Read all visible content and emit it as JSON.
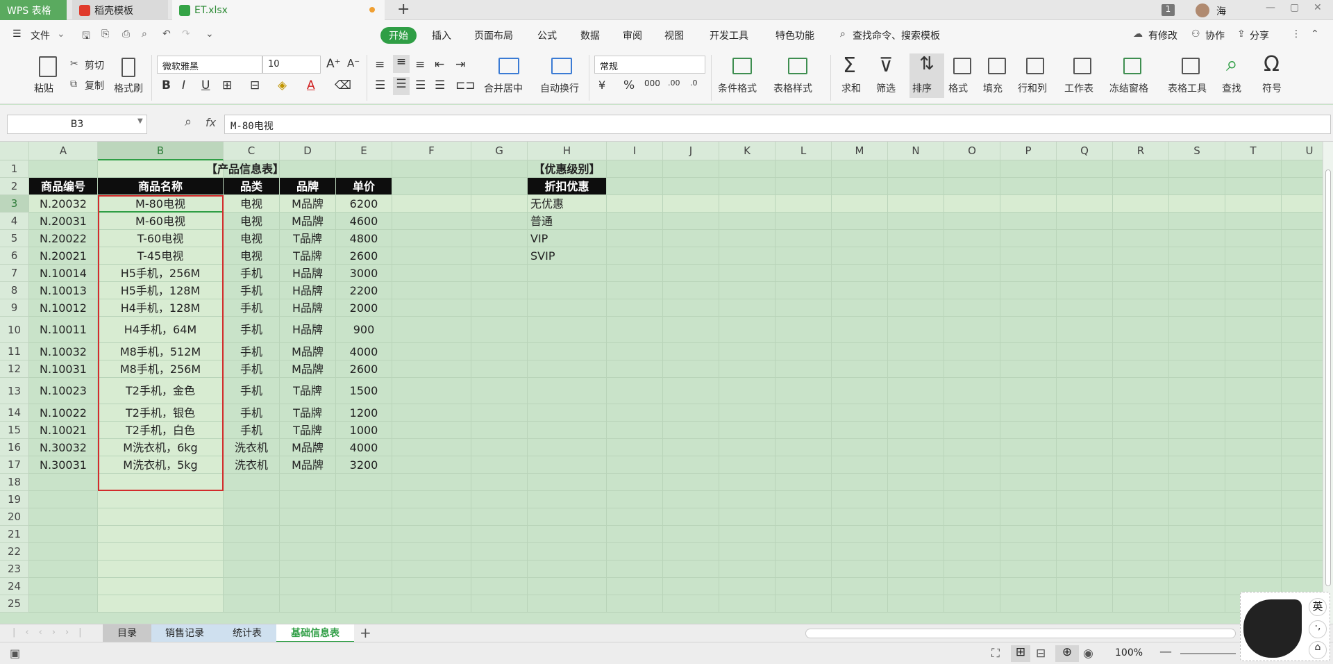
{
  "titlebar": {
    "tabs": [
      {
        "label": "WPS 表格"
      },
      {
        "label": "稻壳模板"
      },
      {
        "label": "ET.xlsx"
      }
    ],
    "add_tab": "+",
    "badge_count": "1",
    "user_name": "海",
    "min": "—",
    "max": "▢",
    "close": "✕"
  },
  "menubar": {
    "file": "文件",
    "items": [
      "开始",
      "插入",
      "页面布局",
      "公式",
      "数据",
      "审阅",
      "视图",
      "开发工具",
      "特色功能"
    ],
    "search": "查找命令、搜索模板",
    "changes": "有修改",
    "collab": "协作",
    "share": "分享"
  },
  "ribbon": {
    "paste": "粘贴",
    "cut": "剪切",
    "copy": "复制",
    "format_painter": "格式刷",
    "font_name": "微软雅黑",
    "font_size": "10",
    "merge": "合并居中",
    "wrap": "自动换行",
    "number_format": "常规",
    "cond_format": "条件格式",
    "table_style": "表格样式",
    "sum": "求和",
    "filter": "筛选",
    "sort": "排序",
    "format": "格式",
    "fill": "填充",
    "rowcol": "行和列",
    "worksheet": "工作表",
    "freeze": "冻结窗格",
    "table_tools": "表格工具",
    "find": "查找",
    "symbol": "符号"
  },
  "formula_bar": {
    "name_box": "B3",
    "fx": "fx",
    "content": "M-80电视"
  },
  "grid": {
    "columns": [
      "A",
      "B",
      "C",
      "D",
      "E",
      "F",
      "G",
      "H",
      "I",
      "J",
      "K",
      "L",
      "M",
      "N",
      "O",
      "P",
      "Q",
      "R",
      "S",
      "T",
      "U"
    ],
    "rows": [
      "1",
      "2",
      "3",
      "4",
      "5",
      "6",
      "7",
      "8",
      "9",
      "10",
      "11",
      "12",
      "13",
      "14",
      "15",
      "16",
      "17",
      "18",
      "19",
      "20",
      "21",
      "22",
      "23",
      "24",
      "25"
    ],
    "product_title": "【产品信息表】",
    "product_headers": [
      "商品编号",
      "商品名称",
      "品类",
      "品牌",
      "单价"
    ],
    "products": [
      [
        "N.20032",
        "M-80电视",
        "电视",
        "M品牌",
        "6200"
      ],
      [
        "N.20031",
        "M-60电视",
        "电视",
        "M品牌",
        "4600"
      ],
      [
        "N.20022",
        "T-60电视",
        "电视",
        "T品牌",
        "4800"
      ],
      [
        "N.20021",
        "T-45电视",
        "电视",
        "T品牌",
        "2600"
      ],
      [
        "N.10014",
        "H5手机，256M",
        "手机",
        "H品牌",
        "3000"
      ],
      [
        "N.10013",
        "H5手机，128M",
        "手机",
        "H品牌",
        "2200"
      ],
      [
        "N.10012",
        "H4手机，128M",
        "手机",
        "H品牌",
        "2000"
      ],
      [
        "N.10011",
        "H4手机，64M",
        "手机",
        "H品牌",
        "900"
      ],
      [
        "N.10032",
        "M8手机，512M",
        "手机",
        "M品牌",
        "4000"
      ],
      [
        "N.10031",
        "M8手机，256M",
        "手机",
        "M品牌",
        "2600"
      ],
      [
        "N.10023",
        "T2手机，金色",
        "手机",
        "T品牌",
        "1500"
      ],
      [
        "N.10022",
        "T2手机，银色",
        "手机",
        "T品牌",
        "1200"
      ],
      [
        "N.10021",
        "T2手机，白色",
        "手机",
        "T品牌",
        "1000"
      ],
      [
        "N.30032",
        "M洗衣机，6kg",
        "洗衣机",
        "M品牌",
        "4000"
      ],
      [
        "N.30031",
        "M洗衣机，5kg",
        "洗衣机",
        "M品牌",
        "3200"
      ]
    ],
    "discount_title": "【优惠级别】",
    "discount_header": "折扣优惠",
    "discounts": [
      "无优惠",
      "普通",
      "VIP",
      "SVIP"
    ]
  },
  "sheets": {
    "tabs": [
      "目录",
      "销售记录",
      "统计表",
      "基础信息表"
    ],
    "active": "基础信息表",
    "add": "+"
  },
  "status": {
    "zoom": "100%",
    "ime_label": "英"
  },
  "colors": {
    "accent": "#2f9e45",
    "sheet_bg": "#c9e3c9",
    "header_cell": "#0d0d0d",
    "selection_border": "#d22b2b"
  }
}
